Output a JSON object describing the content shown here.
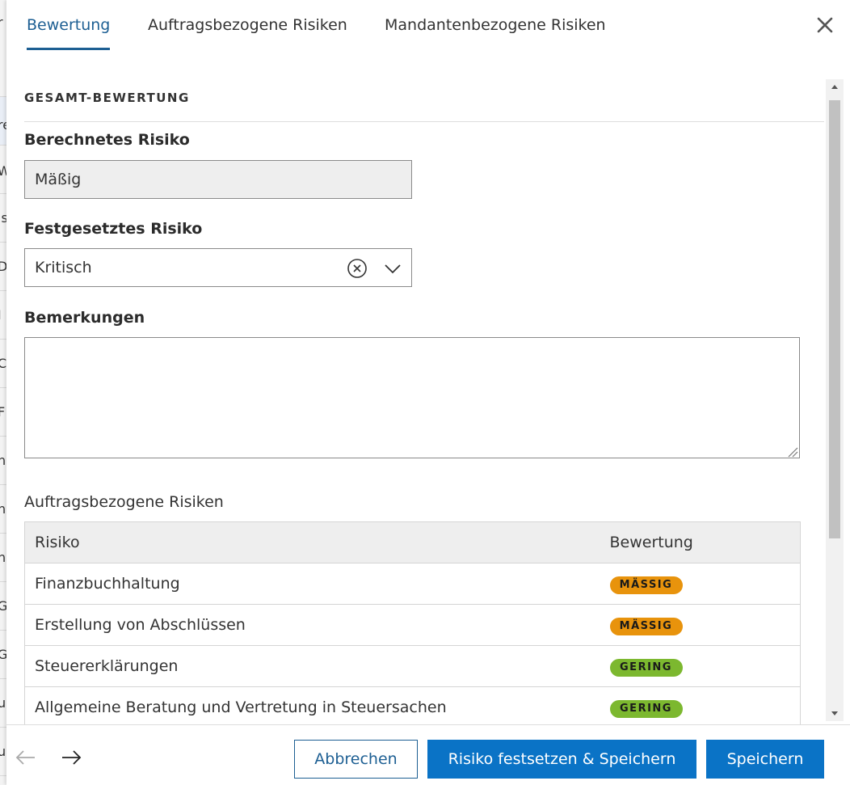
{
  "background_row_chars": [
    "r",
    "re",
    "W",
    "ls",
    "D",
    "I",
    "C",
    "F",
    "n",
    "n",
    "n",
    "G",
    "G",
    "u",
    "u"
  ],
  "tabs": [
    {
      "label": "Bewertung",
      "active": true
    },
    {
      "label": "Auftragsbezogene Risiken",
      "active": false
    },
    {
      "label": "Mandantenbezogene Risiken",
      "active": false
    }
  ],
  "icons": {
    "close": "close-icon",
    "clear": "clear-circle-icon",
    "dropdown": "chevron-down-icon",
    "back": "arrow-left-icon",
    "forward": "arrow-right-icon"
  },
  "section": {
    "title": "GESAMT-BEWERTUNG"
  },
  "calculated_risk": {
    "label": "Berechnetes Risiko",
    "value": "Mäßig"
  },
  "assigned_risk": {
    "label": "Festgesetztes Risiko",
    "value": "Kritisch"
  },
  "remarks": {
    "label": "Bemerkungen",
    "value": "",
    "placeholder": ""
  },
  "job_risks": {
    "heading": "Auftragsbezogene Risiken",
    "columns": [
      "Risiko",
      "Bewertung"
    ],
    "rows": [
      {
        "risk": "Finanzbuchhaltung",
        "rating": "MÄSSIG",
        "color": "#e8930c"
      },
      {
        "risk": "Erstellung von Abschlüssen",
        "rating": "MÄSSIG",
        "color": "#e8930c"
      },
      {
        "risk": "Steuererklärungen",
        "rating": "GERING",
        "color": "#7cb82f"
      },
      {
        "risk": "Allgemeine Beratung und Vertretung in Steuersachen",
        "rating": "GERING",
        "color": "#7cb82f"
      }
    ]
  },
  "footer": {
    "cancel_label": "Abbrechen",
    "assign_save_label": "Risiko festsetzen & Speichern",
    "save_label": "Speichern"
  },
  "colors": {
    "accent": "#1d5f93",
    "primary_button": "#0a73c6",
    "badge_moderate": "#e8930c",
    "badge_low": "#7cb82f"
  }
}
